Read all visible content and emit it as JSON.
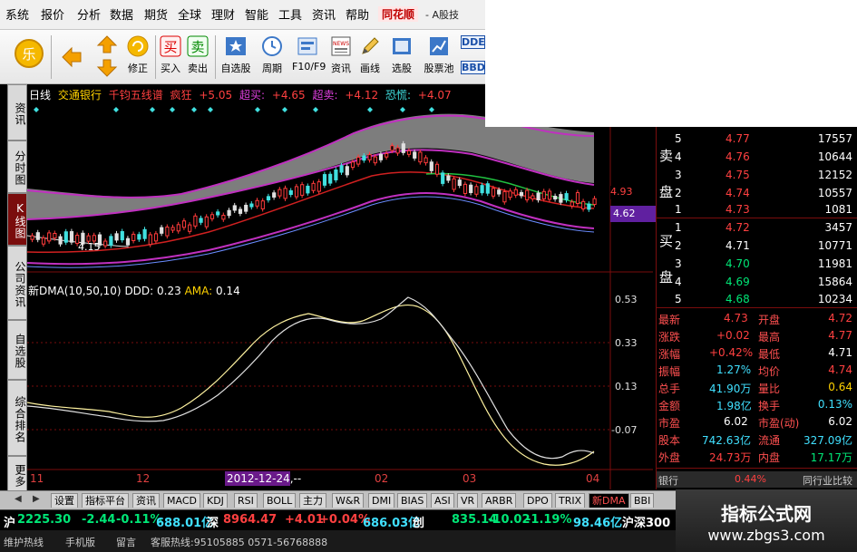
{
  "menu": [
    "系统",
    "报价",
    "分析",
    "数据",
    "期货",
    "全球",
    "理财",
    "智能",
    "工具",
    "资讯",
    "帮助"
  ],
  "brand": "同花顺",
  "window_title": "- A股技",
  "toolbar": [
    {
      "label": "",
      "icon": "logo-le-icon"
    },
    {
      "label": "",
      "icon": "back-arrow-icon"
    },
    {
      "label": "",
      "icon": "up-down-arrows-icon"
    },
    {
      "label": "修正",
      "icon": "correction-icon"
    },
    {
      "label": "买入",
      "icon": "buy-icon"
    },
    {
      "label": "卖出",
      "icon": "sell-icon"
    },
    {
      "label": "自选股",
      "icon": "star-icon"
    },
    {
      "label": "周期",
      "icon": "clock-icon"
    },
    {
      "label": "F10/F9",
      "icon": "f10-icon"
    },
    {
      "label": "资讯",
      "icon": "news-icon"
    },
    {
      "label": "画线",
      "icon": "pencil-icon"
    },
    {
      "label": "选股",
      "icon": "select-stock-icon"
    },
    {
      "label": "股票池",
      "icon": "chart-pool-icon"
    },
    {
      "label": "DDE",
      "icon": "dde-icon"
    },
    {
      "label": "BBD",
      "icon": "bbd-icon"
    }
  ],
  "left_tabs": [
    "资讯",
    "分时图",
    "K线图",
    "公司资讯",
    "自选股",
    "综合排名",
    "更多"
  ],
  "chart_header": {
    "period": "日线",
    "stock_name": "交通银行",
    "indicator": "千钧五线谱",
    "stage": "疯狂",
    "items": [
      {
        "value": "+5.05",
        "label": "超买:"
      },
      {
        "value": "+4.65",
        "label": "超卖:"
      },
      {
        "value": "+4.12",
        "label": "恐慌:"
      },
      {
        "value": "+4.07",
        "label": ""
      }
    ]
  },
  "main_chart_labels": {
    "low_price": "4.15",
    "price_line": "4.93",
    "current_price": "4.62"
  },
  "indicator_header": {
    "name": "新DMA(10,50,10)",
    "ddd_label": "DDD:",
    "ddd_value": "0.23",
    "ama_label": "AMA:",
    "ama_value": "0.14"
  },
  "ind_axis": [
    "0.53",
    "0.33",
    "0.13",
    "-0.07"
  ],
  "date_axis": [
    "11",
    "12",
    "2012-12-24,--",
    "02",
    "03",
    "04"
  ],
  "order_book": {
    "sell": [
      {
        "label": "5",
        "price": "4.77",
        "vol": "17557"
      },
      {
        "label": "4",
        "price": "4.76",
        "vol": "10644"
      },
      {
        "label": "3",
        "price": "4.75",
        "vol": "12152"
      },
      {
        "label": "2",
        "price": "4.74",
        "vol": "10557"
      },
      {
        "label": "1",
        "price": "4.73",
        "vol": "1081"
      }
    ],
    "sell_title": [
      "卖",
      "盘"
    ],
    "buy": [
      {
        "label": "1",
        "price": "4.72",
        "vol": "3457"
      },
      {
        "label": "2",
        "price": "4.71",
        "vol": "10771"
      },
      {
        "label": "3",
        "price": "4.70",
        "vol": "11981"
      },
      {
        "label": "4",
        "price": "4.69",
        "vol": "15864"
      },
      {
        "label": "5",
        "price": "4.68",
        "vol": "10234"
      }
    ],
    "buy_title": [
      "买",
      "盘"
    ]
  },
  "quote": [
    {
      "l1": "最新",
      "v1": "4.73",
      "l2": "开盘",
      "v2": "4.72"
    },
    {
      "l1": "涨跌",
      "v1": "+0.02",
      "l2": "最高",
      "v2": "4.77"
    },
    {
      "l1": "涨幅",
      "v1": "+0.42%",
      "l2": "最低",
      "v2": "4.71"
    },
    {
      "l1": "振幅",
      "v1": "1.27%",
      "l2": "均价",
      "v2": "4.74"
    },
    {
      "l1": "总手",
      "v1": "41.90万",
      "l2": "量比",
      "v2": "0.64"
    },
    {
      "l1": "金额",
      "v1": "1.98亿",
      "l2": "换手",
      "v2": "0.13%"
    },
    {
      "l1": "市盈",
      "v1": "6.02",
      "l2": "市盈(动)",
      "v2": "6.02"
    },
    {
      "l1": "股本",
      "v1": "742.63亿",
      "l2": "流通",
      "v2": "327.09亿"
    },
    {
      "l1": "外盘",
      "v1": "24.73万",
      "l2": "内盘",
      "v2": "17.17万"
    }
  ],
  "sector_row": {
    "label": "银行",
    "pct": "0.44%",
    "compare": "同行业比较"
  },
  "bottom_tabs": [
    "设置",
    "指标平台",
    "资讯",
    "MACD",
    "KDJ",
    "RSI",
    "BOLL",
    "主力",
    "W&R",
    "DMI",
    "BIAS",
    "ASI",
    "VR",
    "ARBR",
    "DPO",
    "TRIX",
    "新DMA",
    "BBI"
  ],
  "bottom_tab_active": "新DMA",
  "status": {
    "sh_label": "沪",
    "sh_index": "2225.30",
    "sh_chg": "-2.44",
    "sh_pct": "-0.11%",
    "sh_amt": "688.01亿",
    "sz_label": "深",
    "sz_index": "8964.47",
    "sz_chg": "+4.01",
    "sz_pct": "+0.04%",
    "sz_amt": "686.03亿",
    "cy_label": "创",
    "cy_index": "835.14",
    "cy_chg": "-10.02",
    "cy_pct": "-1.19%",
    "cy_amt": "98.46亿",
    "hs_label": "沪深300"
  },
  "bottom_bar": [
    "维护热线",
    "手机版",
    "留言",
    "客服热线:95105885 0571-56768888"
  ],
  "watermark": {
    "title": "指标公式网",
    "url": "www.zbgs3.com"
  },
  "colors": {
    "up": "#ff3b3b",
    "down": "#00e676",
    "neutral": "#ffffff",
    "accent_purple": "#c030c0",
    "cloud_gray": "#808080"
  }
}
